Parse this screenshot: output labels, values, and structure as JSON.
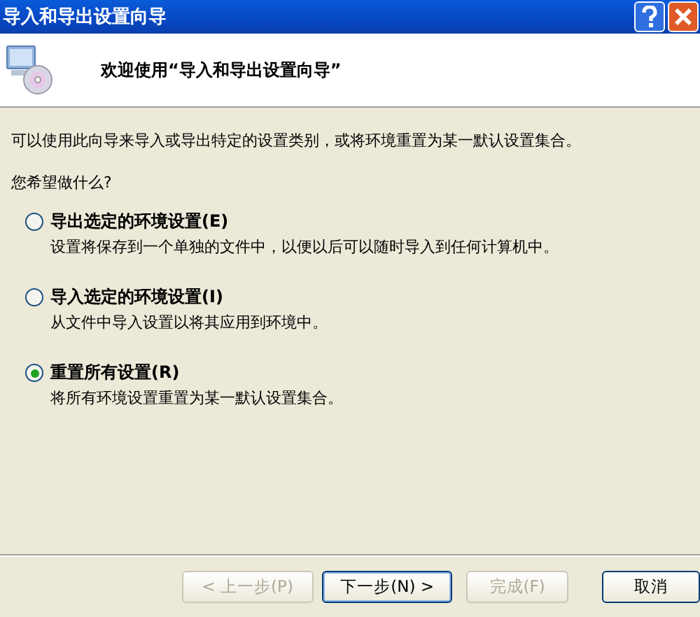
{
  "window": {
    "title": "导入和导出设置向导"
  },
  "header": {
    "heading": "欢迎使用“导入和导出设置向导”"
  },
  "description": "可以使用此向导来导入或导出特定的设置类别，或将环境重置为某一默认设置集合。",
  "question": "您希望做什么?",
  "options": [
    {
      "label": "导出选定的环境设置(E)",
      "detail": "设置将保存到一个单独的文件中，以便以后可以随时导入到任何计算机中。",
      "selected": false
    },
    {
      "label": "导入选定的环境设置(I)",
      "detail": "从文件中导入设置以将其应用到环境中。",
      "selected": false
    },
    {
      "label": "重置所有设置(R)",
      "detail": "将所有环境设置重置为某一默认设置集合。",
      "selected": true
    }
  ],
  "buttons": [
    {
      "label": "< 上一步(P)",
      "disabled": true,
      "default": false
    },
    {
      "label": "下一步(N) >",
      "disabled": false,
      "default": true
    },
    {
      "label": "完成(F)",
      "disabled": true,
      "default": false
    },
    {
      "label": "取消",
      "disabled": false,
      "default": false
    }
  ]
}
